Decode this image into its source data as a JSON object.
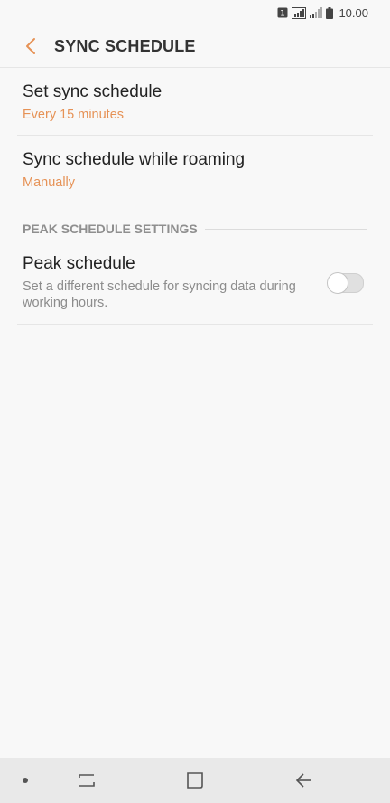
{
  "status_bar": {
    "sim_badge": "1",
    "time": "10.00"
  },
  "header": {
    "title": "SYNC SCHEDULE"
  },
  "settings": {
    "set_sync_schedule": {
      "title": "Set sync schedule",
      "value": "Every 15 minutes"
    },
    "roaming_schedule": {
      "title": "Sync schedule while roaming",
      "value": "Manually"
    }
  },
  "peak_section": {
    "header": "PEAK SCHEDULE SETTINGS",
    "peak_schedule": {
      "title": "Peak schedule",
      "description": "Set a different schedule for syncing data during working hours.",
      "enabled": false
    }
  },
  "colors": {
    "accent": "#e69256",
    "background": "#f8f8f8",
    "nav_bar": "#e9e9e9"
  },
  "icons": {
    "back": "chevron-left-icon",
    "recents": "recents-icon",
    "home": "home-icon",
    "nav_back": "back-arrow-icon"
  }
}
